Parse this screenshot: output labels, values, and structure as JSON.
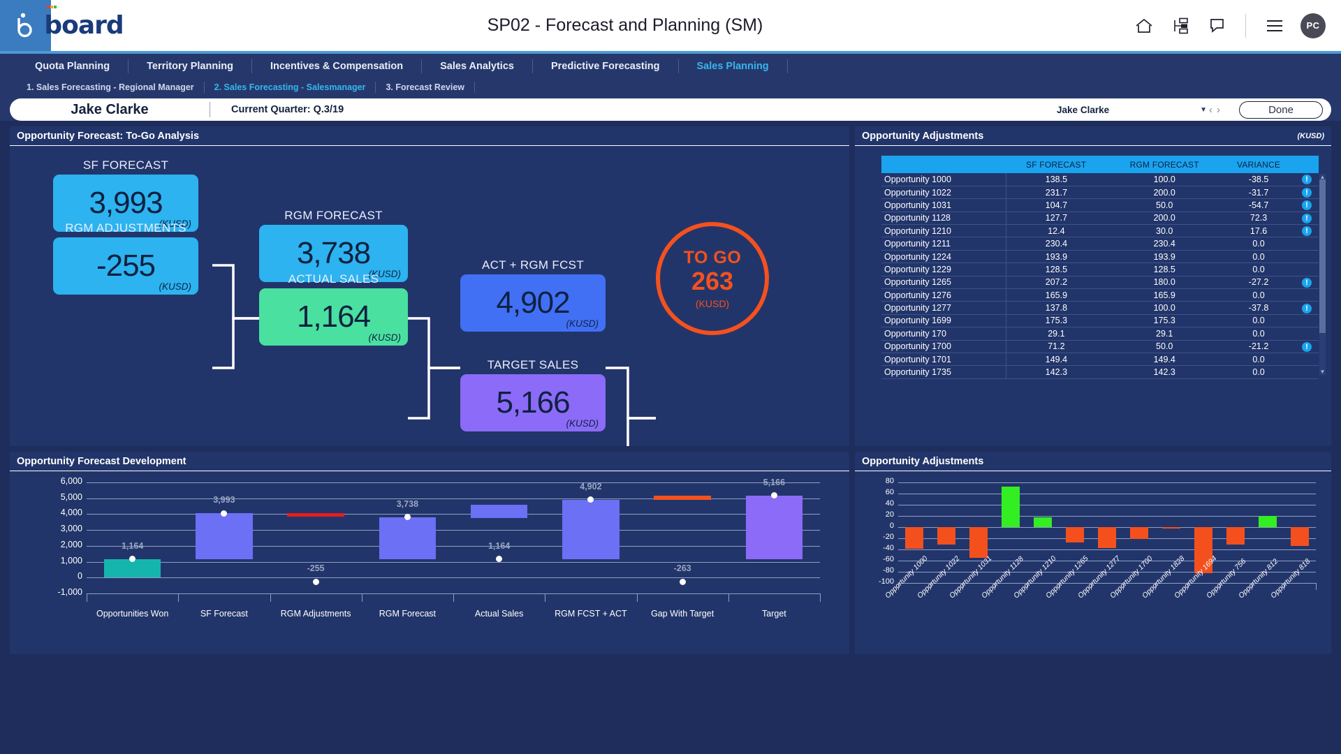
{
  "header": {
    "title": "SP02 - Forecast and Planning (SM)",
    "brand": "board",
    "logo_mark": "b",
    "icons": [
      "home-icon",
      "hierarchy-icon",
      "comment-icon",
      "hamburger-menu-icon"
    ],
    "avatar_initials": "PC"
  },
  "mainnav": {
    "items": [
      {
        "label": "Quota Planning",
        "active": false
      },
      {
        "label": "Territory Planning",
        "active": false
      },
      {
        "label": "Incentives & Compensation",
        "active": false
      },
      {
        "label": "Sales Analytics",
        "active": false
      },
      {
        "label": "Predictive Forecasting",
        "active": false
      },
      {
        "label": "Sales Planning",
        "active": true
      }
    ]
  },
  "subnav": {
    "items": [
      {
        "label": "1. Sales Forecasting - Regional Manager",
        "active": false
      },
      {
        "label": "2. Sales Forecasting - Salesmanager",
        "active": true
      },
      {
        "label": "3. Forecast Review",
        "active": false
      }
    ]
  },
  "userbar": {
    "user_name": "Jake Clarke",
    "quarter": "Current Quarter: Q.3/19",
    "selector_value": "Jake Clarke",
    "caret": "▼",
    "prev": "‹",
    "next": "›",
    "done_label": "Done"
  },
  "flow_panel": {
    "title": "Opportunity Forecast: To-Go Analysis",
    "cards": [
      {
        "label": "SF FORECAST",
        "value": "3,993",
        "unit": "(KUSD)",
        "color": "#2cb3f0"
      },
      {
        "label": "RGM ADJUSTMENTS",
        "value": "-255",
        "unit": "(KUSD)",
        "color": "#2cb3f0"
      },
      {
        "label": "RGM FORECAST",
        "value": "3,738",
        "unit": "(KUSD)",
        "color": "#2cb3f0"
      },
      {
        "label": "ACTUAL SALES",
        "value": "1,164",
        "unit": "(KUSD)",
        "color": "#4ae0a0"
      },
      {
        "label": "ACT + RGM FCST",
        "value": "4,902",
        "unit": "(KUSD)",
        "color": "#4170f5"
      },
      {
        "label": "TARGET SALES",
        "value": "5,166",
        "unit": "(KUSD)",
        "color": "#8b6bf7"
      }
    ],
    "togo": {
      "label": "TO GO",
      "value": "263",
      "unit": "(KUSD)",
      "color": "#f4511e"
    }
  },
  "table_panel": {
    "title": "Opportunity Adjustments",
    "unit": "(KUSD)",
    "columns": [
      "",
      "SF FORECAST",
      "RGM FORECAST",
      "VARIANCE",
      ""
    ],
    "rows": [
      {
        "name": "Opportunity 1000",
        "sf": "138.5",
        "rgm": "100.0",
        "var": "-38.5",
        "flag": true
      },
      {
        "name": "Opportunity 1022",
        "sf": "231.7",
        "rgm": "200.0",
        "var": "-31.7",
        "flag": true
      },
      {
        "name": "Opportunity 1031",
        "sf": "104.7",
        "rgm": "50.0",
        "var": "-54.7",
        "flag": true
      },
      {
        "name": "Opportunity 1128",
        "sf": "127.7",
        "rgm": "200.0",
        "var": "72.3",
        "flag": true
      },
      {
        "name": "Opportunity 1210",
        "sf": "12.4",
        "rgm": "30.0",
        "var": "17.6",
        "flag": true
      },
      {
        "name": "Opportunity 1211",
        "sf": "230.4",
        "rgm": "230.4",
        "var": "0.0",
        "flag": false
      },
      {
        "name": "Opportunity 1224",
        "sf": "193.9",
        "rgm": "193.9",
        "var": "0.0",
        "flag": false
      },
      {
        "name": "Opportunity 1229",
        "sf": "128.5",
        "rgm": "128.5",
        "var": "0.0",
        "flag": false
      },
      {
        "name": "Opportunity 1265",
        "sf": "207.2",
        "rgm": "180.0",
        "var": "-27.2",
        "flag": true
      },
      {
        "name": "Opportunity 1276",
        "sf": "165.9",
        "rgm": "165.9",
        "var": "0.0",
        "flag": false
      },
      {
        "name": "Opportunity 1277",
        "sf": "137.8",
        "rgm": "100.0",
        "var": "-37.8",
        "flag": true
      },
      {
        "name": "Opportunity 1699",
        "sf": "175.3",
        "rgm": "175.3",
        "var": "0.0",
        "flag": false
      },
      {
        "name": "Opportunity 170",
        "sf": "29.1",
        "rgm": "29.1",
        "var": "0.0",
        "flag": false
      },
      {
        "name": "Opportunity 1700",
        "sf": "71.2",
        "rgm": "50.0",
        "var": "-21.2",
        "flag": true
      },
      {
        "name": "Opportunity 1701",
        "sf": "149.4",
        "rgm": "149.4",
        "var": "0.0",
        "flag": false
      },
      {
        "name": "Opportunity 1735",
        "sf": "142.3",
        "rgm": "142.3",
        "var": "0.0",
        "flag": false
      }
    ]
  },
  "waterfall_panel": {
    "title": "Opportunity Forecast Development"
  },
  "adjchart_panel": {
    "title": "Opportunity Adjustments"
  },
  "chart_data": [
    {
      "type": "bar",
      "title": "Opportunity Forecast Development",
      "xlabel": "",
      "ylabel": "",
      "ylim": [
        -1000,
        6000
      ],
      "yticks": [
        "6,000",
        "5,000",
        "4,000",
        "3,000",
        "2,000",
        "1,000",
        "0",
        "-1,000"
      ],
      "grid": true,
      "legend": "none",
      "categories": [
        "Opportunities Won",
        "SF Forecast",
        "RGM Adjustments",
        "RGM Forecast",
        "Actual Sales",
        "RGM FCST + ACT",
        "Gap With Target",
        "Target"
      ],
      "bars": [
        {
          "category": "Opportunities Won",
          "base": 0,
          "top": 1164,
          "color": "#15b5ae",
          "label": "1,164",
          "marker": 1164
        },
        {
          "category": "SF Forecast",
          "base": 1164,
          "top": 4060,
          "color": "#6c70f5",
          "label": "3,993",
          "marker": 4060
        },
        {
          "category": "RGM Adjustments",
          "base": 3993,
          "top": 4060,
          "color": "#e81c1c",
          "label": "-255",
          "marker": -255
        },
        {
          "category": "RGM Forecast",
          "base": 1164,
          "top": 3800,
          "color": "#6c70f5",
          "label": "3,738",
          "marker": 3800
        },
        {
          "category": "Actual Sales",
          "base": 3738,
          "top": 4600,
          "color": "#6c70f5",
          "label": "1,164",
          "marker": 1164
        },
        {
          "category": "RGM FCST + ACT",
          "base": 1164,
          "top": 4902,
          "color": "#6c70f5",
          "label": "4,902",
          "marker": 4902
        },
        {
          "category": "Gap With Target",
          "base": 4902,
          "top": 5166,
          "color": "#f4511e",
          "label": "-263",
          "marker": -263
        },
        {
          "category": "Target",
          "base": 1164,
          "top": 5166,
          "color": "#8b6bf7",
          "label": "5,166",
          "marker": 5166
        }
      ]
    },
    {
      "type": "bar",
      "title": "Opportunity Adjustments",
      "xlabel": "",
      "ylabel": "",
      "ylim": [
        -100,
        80
      ],
      "yticks": [
        "80",
        "60",
        "40",
        "20",
        "0",
        "-20",
        "-40",
        "-60",
        "-80",
        "-100"
      ],
      "grid": true,
      "legend": "none",
      "categories": [
        "Opportunity 1000",
        "Opportunity 1022",
        "Opportunity 1031",
        "Opportunity 1128",
        "Opportunity 1210",
        "Opportunity 1265",
        "Opportunity 1277",
        "Opportunity 1700",
        "Opportunity 1828",
        "Opportunity 1694",
        "Opportunity 756",
        "Opportunity 812",
        "Opportunity 818"
      ],
      "values": [
        -38.5,
        -31.7,
        -54.7,
        72.3,
        17.6,
        -27.2,
        -37.8,
        -21.2,
        -1.0,
        -83.0,
        -31.0,
        19.5,
        -34.0
      ],
      "pos_color": "#33ee22",
      "neg_color": "#f4501e"
    }
  ]
}
